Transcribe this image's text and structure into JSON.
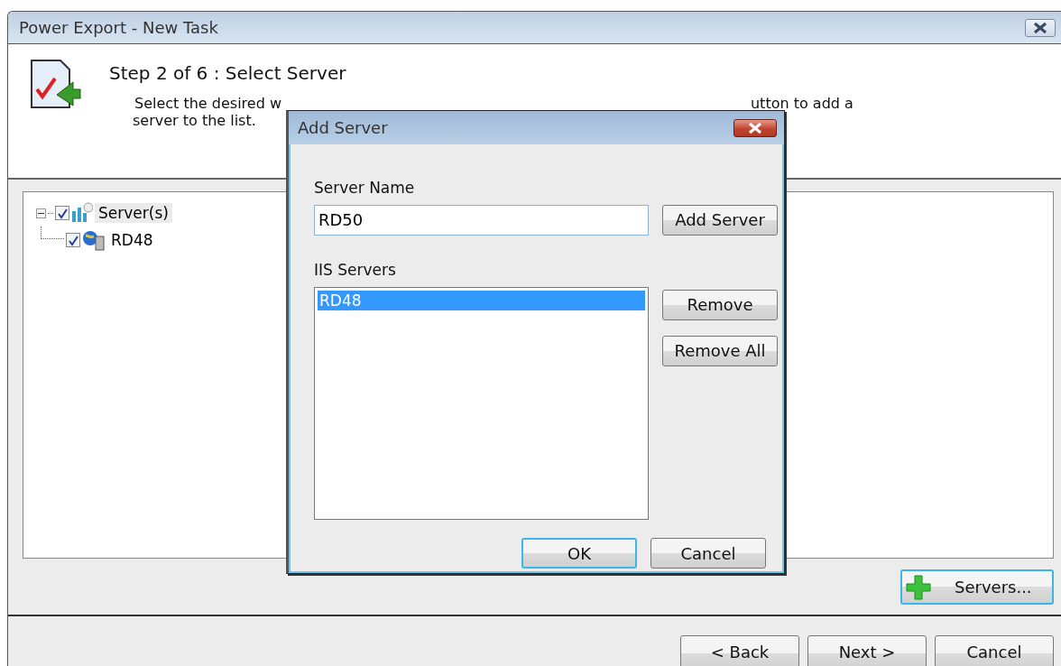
{
  "window": {
    "title": "Power Export - New Task"
  },
  "header": {
    "step": "Step 2 of 6 : Select Server",
    "description_visible": [
      "Select the desired w",
      "utton to add a",
      "server to the list."
    ]
  },
  "tree": {
    "items": [
      {
        "label": "Server(s)",
        "checked": true,
        "expanded": true,
        "selected": true,
        "children": [
          {
            "label": "RD48",
            "checked": true,
            "selected": false
          }
        ]
      }
    ]
  },
  "servers_button": {
    "label": "Servers..."
  },
  "nav_buttons": [
    {
      "label": "< Back"
    },
    {
      "label": "Next >"
    },
    {
      "label": "Cancel"
    }
  ],
  "dialog": {
    "title": "Add Server",
    "server_name_label": "Server Name",
    "server_name_value": "RD50",
    "add_button": "Add Server",
    "list_label": "IIS Servers",
    "list_items": [
      {
        "label": "RD48",
        "selected": true
      }
    ],
    "side_buttons": [
      "Remove",
      "Remove All"
    ],
    "ok": "OK",
    "cancel": "Cancel"
  }
}
